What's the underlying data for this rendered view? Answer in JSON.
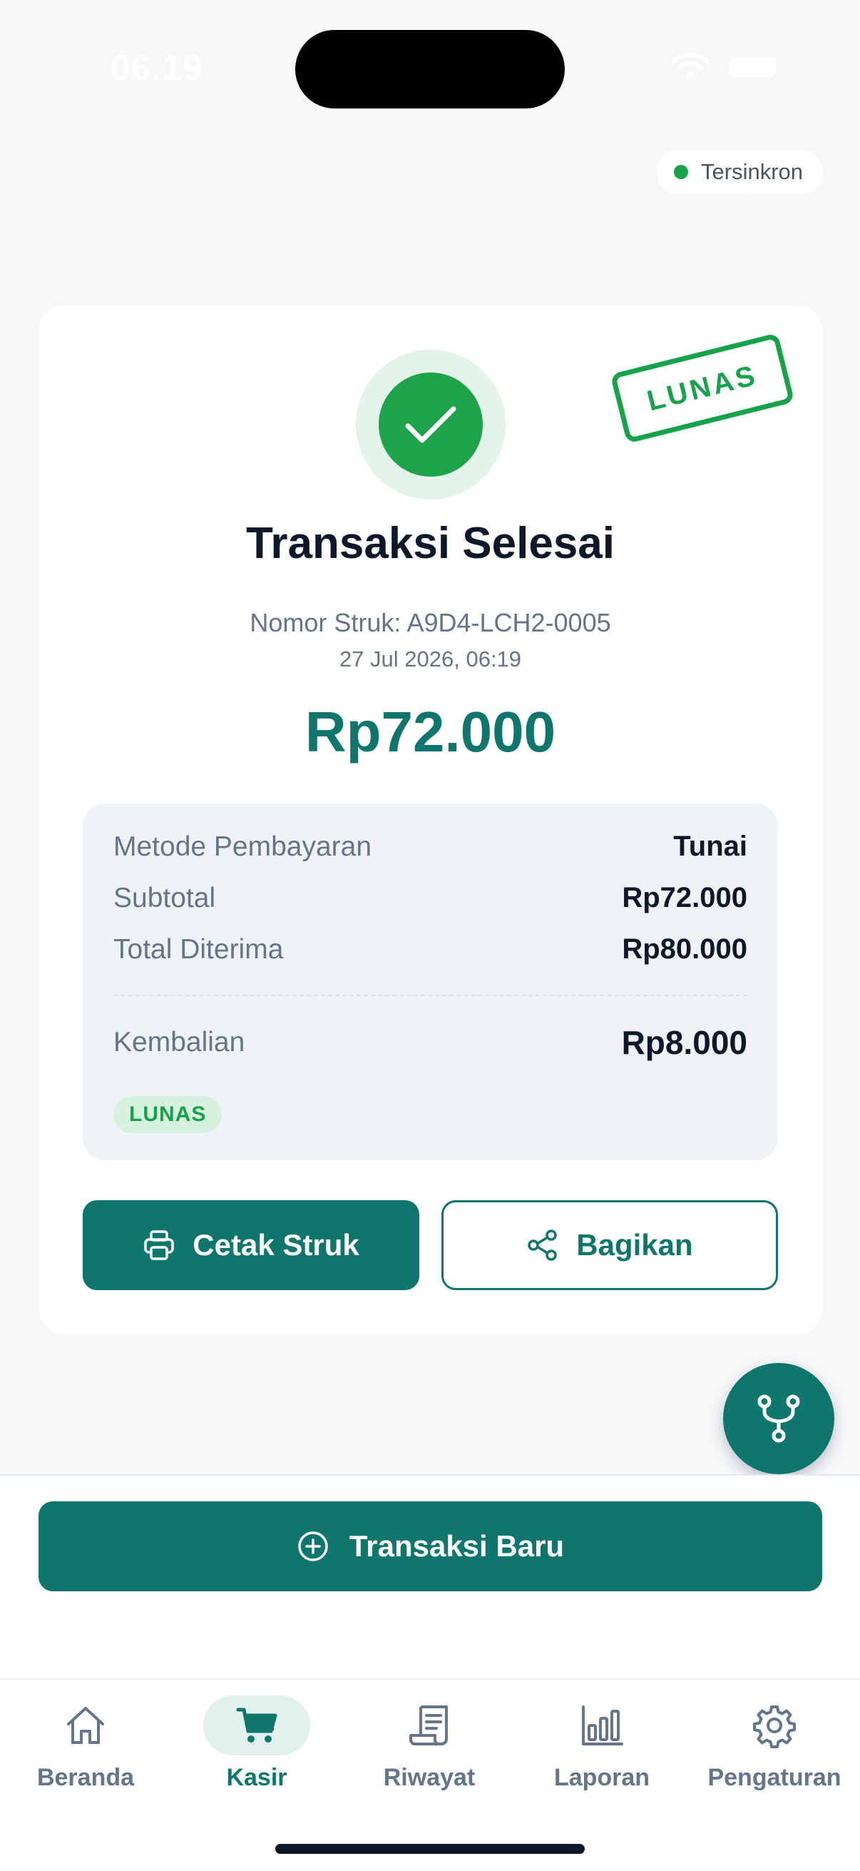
{
  "status_bar": {
    "time": "06.19"
  },
  "sync": {
    "label": "Tersinkron",
    "color": "#16a34a"
  },
  "receipt": {
    "stamp": "LUNAS",
    "title": "Transaksi Selesai",
    "receipt_number": "Nomor Struk: A9D4-LCH2-0005",
    "datetime": "27 Jul 2026, 06:19",
    "amount": "Rp72.000",
    "summary": {
      "rows": [
        {
          "label": "Metode Pembayaran",
          "value": "Tunai"
        },
        {
          "label": "Subtotal",
          "value": "Rp72.000"
        },
        {
          "label": "Total Diterima",
          "value": "Rp80.000"
        }
      ],
      "change": {
        "label": "Kembalian",
        "value": "Rp8.000"
      },
      "badge": "LUNAS"
    },
    "actions": {
      "print_label": "Cetak Struk",
      "print_icon": "printer-icon",
      "share_label": "Bagikan",
      "share_icon": "share-icon"
    }
  },
  "fab": {
    "icon": "branch-icon"
  },
  "new_transaction": {
    "label": "Transaksi Baru",
    "icon": "plus-circle-icon"
  },
  "tabs": [
    {
      "label": "Beranda",
      "icon": "home-icon",
      "active": false
    },
    {
      "label": "Kasir",
      "icon": "cart-icon",
      "active": true
    },
    {
      "label": "Riwayat",
      "icon": "receipt-icon",
      "active": false
    },
    {
      "label": "Laporan",
      "icon": "bar-chart-icon",
      "active": false
    },
    {
      "label": "Pengaturan",
      "icon": "gear-icon",
      "active": false
    }
  ],
  "colors": {
    "primary": "#0f766e",
    "success": "#16a34a",
    "success_bg": "#e3f4ea",
    "background": "#f6f8fa"
  }
}
